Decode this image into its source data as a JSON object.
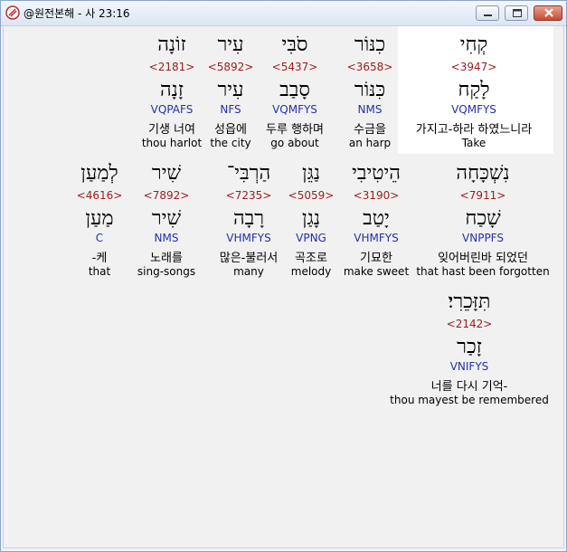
{
  "window": {
    "title": "@원전본해 - 사 23:16"
  },
  "rows": [
    [
      {
        "heb1": "קְחִי",
        "strong": "<3947>",
        "heb2": "לָקַח",
        "morph": "VQMFYS",
        "kor": "가지고-하라 하였느니라",
        "eng": "Take"
      },
      {
        "heb1": "כִנּוֹר",
        "strong": "<3658>",
        "heb2": "כִּנּוֹר",
        "morph": "NMS",
        "kor": "수금을",
        "eng": "an harp"
      },
      {
        "heb1": "סֹבִּי",
        "strong": "<5437>",
        "heb2": "סָבַב",
        "morph": "VQMFYS",
        "kor": "두루 행하며",
        "eng": "go about"
      },
      {
        "heb1": "עִיר",
        "strong": "<5892>",
        "heb2": "עִיר",
        "morph": "NFS",
        "kor": "성읍에",
        "eng": "the city"
      },
      {
        "heb1": "זוֹנָה",
        "strong": "<2181>",
        "heb2": "זָנָה",
        "morph": "VQPAFS",
        "kor": "기생 너여",
        "eng": "thou harlot"
      }
    ],
    [
      {
        "heb1": "נִשְׁכָּחָה",
        "strong": "<7911>",
        "heb2": "שָׁכַח",
        "morph": "VNPPFS",
        "kor": "잊어버린바 되었던",
        "eng": "that hast been forgotten"
      },
      {
        "heb1": "הֵיטִיבִי",
        "strong": "<3190>",
        "heb2": "יָטַב",
        "morph": "VHMFYS",
        "kor": "기묘한",
        "eng": "make sweet"
      },
      {
        "heb1": "נַגֵּן",
        "strong": "<5059>",
        "heb2": "נָגַן",
        "morph": "VPNG",
        "kor": "곡조로",
        "eng": "melody"
      },
      {
        "heb1": "הַרְבִּי־",
        "strong": "<7235>",
        "heb2": "רָבָה",
        "morph": "VHMFYS",
        "kor": "많은-불러서",
        "eng": "many"
      },
      {
        "heb1": "שִׁיר",
        "strong": "<7892>",
        "heb2": "שִׁיר",
        "morph": "NMS",
        "kor": "노래를",
        "eng": "sing-songs"
      },
      {
        "heb1": "לְמַעַן",
        "strong": "<4616>",
        "heb2": "מַעַן",
        "morph": "C",
        "kor": "-케",
        "eng": "that"
      }
    ],
    [
      {
        "heb1": "תִּזָּכֵרִי׃",
        "strong": "<2142>",
        "heb2": "זָכַר",
        "morph": "VNIFYS",
        "kor": "너를 다시 기억-",
        "eng": "thou mayest be remembered"
      }
    ]
  ]
}
